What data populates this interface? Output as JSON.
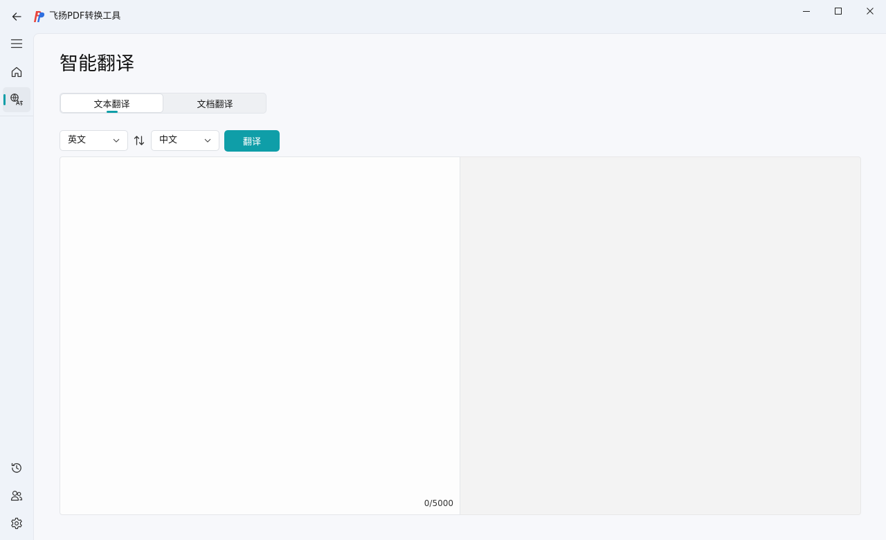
{
  "app": {
    "title": "飞扬PDF转换工具",
    "accent_color": "#0f9ea8"
  },
  "titlebar": {
    "icons": [
      "back-arrow-icon",
      "app-logo",
      "minimize-icon",
      "maximize-icon",
      "close-icon"
    ]
  },
  "sidebar": {
    "top_items": [
      {
        "name": "menu",
        "icon": "hamburger-menu-icon"
      },
      {
        "name": "home",
        "icon": "home-icon"
      },
      {
        "name": "translate",
        "icon": "translate-icon",
        "active": true
      }
    ],
    "bottom_items": [
      {
        "name": "history",
        "icon": "history-icon"
      },
      {
        "name": "account",
        "icon": "users-icon"
      },
      {
        "name": "settings",
        "icon": "gear-icon"
      }
    ]
  },
  "page": {
    "title": "智能翻译",
    "tabs": [
      {
        "label": "文本翻译",
        "active": true
      },
      {
        "label": "文档翻译",
        "active": false
      }
    ]
  },
  "translator": {
    "source_language": "英文",
    "target_language": "中文",
    "translate_label": "翻译",
    "source_text": "",
    "char_count": "0/5000",
    "output_text": ""
  }
}
